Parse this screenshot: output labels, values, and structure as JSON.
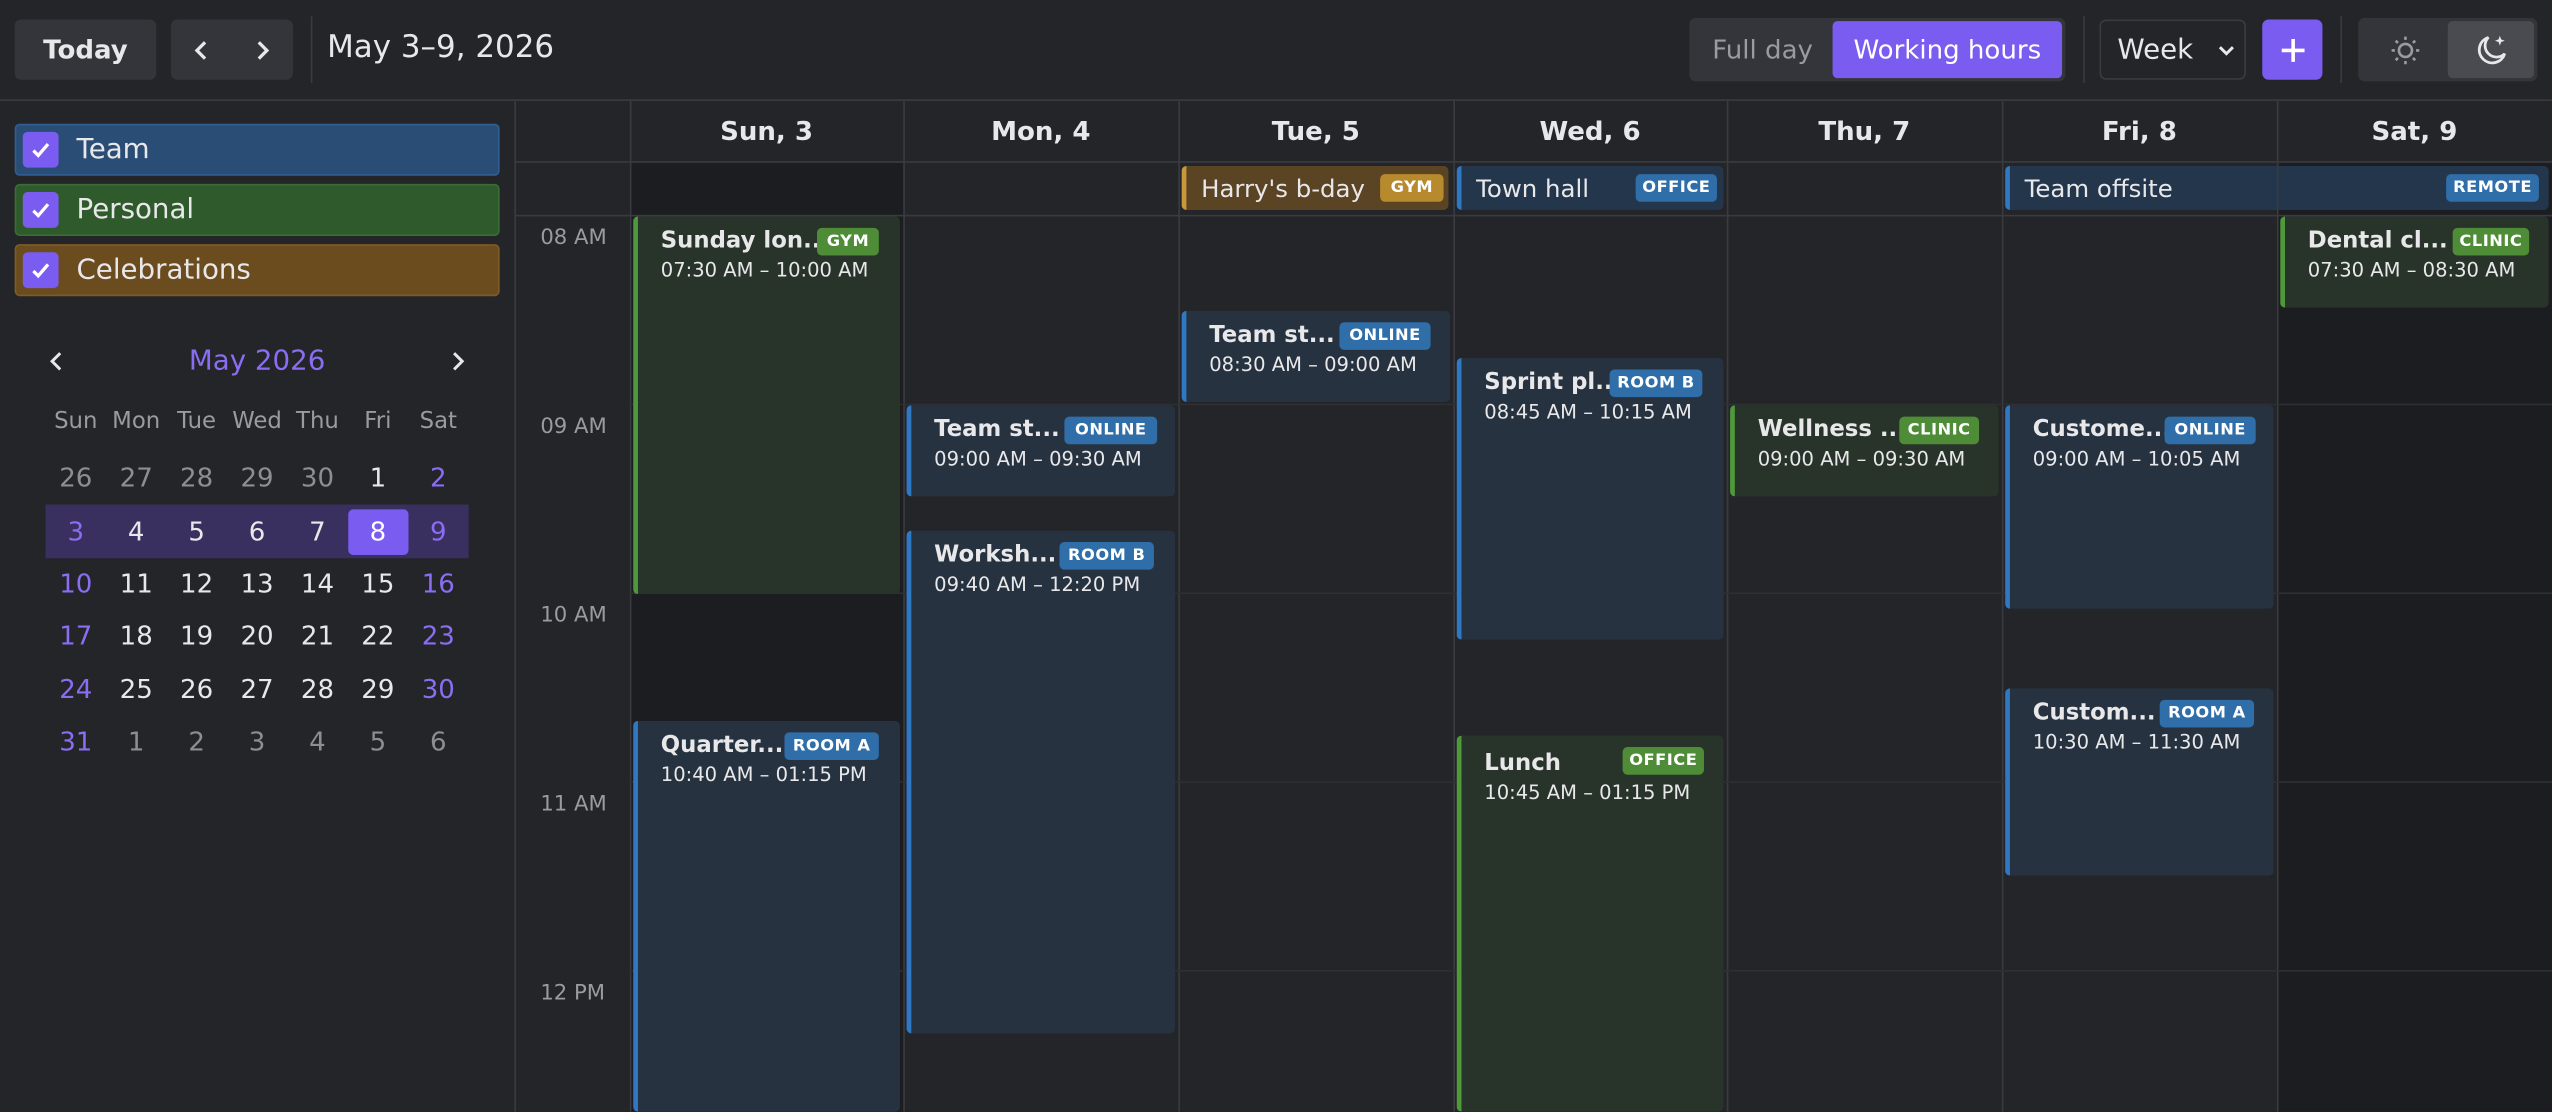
{
  "toolbar": {
    "today_label": "Today",
    "date_range": "May 3–9, 2026",
    "full_day_label": "Full day",
    "working_hours_label": "Working hours",
    "view_label": "Week"
  },
  "calendars": [
    {
      "label": "Team",
      "color": "#2a4d75"
    },
    {
      "label": "Personal",
      "color": "#2f5a2b"
    },
    {
      "label": "Celebrations",
      "color": "#6b4c1f"
    }
  ],
  "mini_calendar": {
    "title": "May 2026",
    "weekdays": [
      "Sun",
      "Mon",
      "Tue",
      "Wed",
      "Thu",
      "Fri",
      "Sat"
    ],
    "weeks": [
      [
        "26",
        "27",
        "28",
        "29",
        "30",
        "1",
        "2"
      ],
      [
        "3",
        "4",
        "5",
        "6",
        "7",
        "8",
        "9"
      ],
      [
        "10",
        "11",
        "12",
        "13",
        "14",
        "15",
        "16"
      ],
      [
        "17",
        "18",
        "19",
        "20",
        "21",
        "22",
        "23"
      ],
      [
        "24",
        "25",
        "26",
        "27",
        "28",
        "29",
        "30"
      ],
      [
        "31",
        "1",
        "2",
        "3",
        "4",
        "5",
        "6"
      ]
    ]
  },
  "days": [
    "Sun, 3",
    "Mon, 4",
    "Tue, 5",
    "Wed, 6",
    "Thu, 7",
    "Fri, 8",
    "Sat, 9"
  ],
  "hours": [
    "08 AM",
    "09 AM",
    "10 AM",
    "11 AM",
    "12 PM"
  ],
  "all_day_events": [
    {
      "title": "Harry's b-day",
      "tag": "GYM"
    },
    {
      "title": "Town hall",
      "tag": "OFFICE"
    },
    {
      "title": "Team offsite",
      "tag": "REMOTE"
    }
  ],
  "events": [
    {
      "title": "Sunday lon...",
      "tag": "GYM",
      "time": "07:30 AM – 10:00 AM"
    },
    {
      "title": "Quarter...",
      "tag": "ROOM A",
      "time": "10:40 AM – 01:15 PM"
    },
    {
      "title": "Team st...",
      "tag": "ONLINE",
      "time": "09:00 AM – 09:30 AM"
    },
    {
      "title": "Worksh...",
      "tag": "ROOM B",
      "time": "09:40 AM – 12:20 PM"
    },
    {
      "title": "Team st...",
      "tag": "ONLINE",
      "time": "08:30 AM – 09:00 AM"
    },
    {
      "title": "Sprint pl...",
      "tag": "ROOM B",
      "time": "08:45 AM – 10:15 AM"
    },
    {
      "title": "Lunch",
      "tag": "OFFICE",
      "time": "10:45 AM – 01:15 PM"
    },
    {
      "title": "Wellness ...",
      "tag": "CLINIC",
      "time": "09:00 AM – 09:30 AM"
    },
    {
      "title": "Custome...",
      "tag": "ONLINE",
      "time": "09:00 AM – 10:05 AM"
    },
    {
      "title": "Custom...",
      "tag": "ROOM A",
      "time": "10:30 AM – 11:30 AM"
    },
    {
      "title": "Dental cl...",
      "tag": "CLINIC",
      "time": "07:30 AM – 08:30 AM"
    }
  ]
}
